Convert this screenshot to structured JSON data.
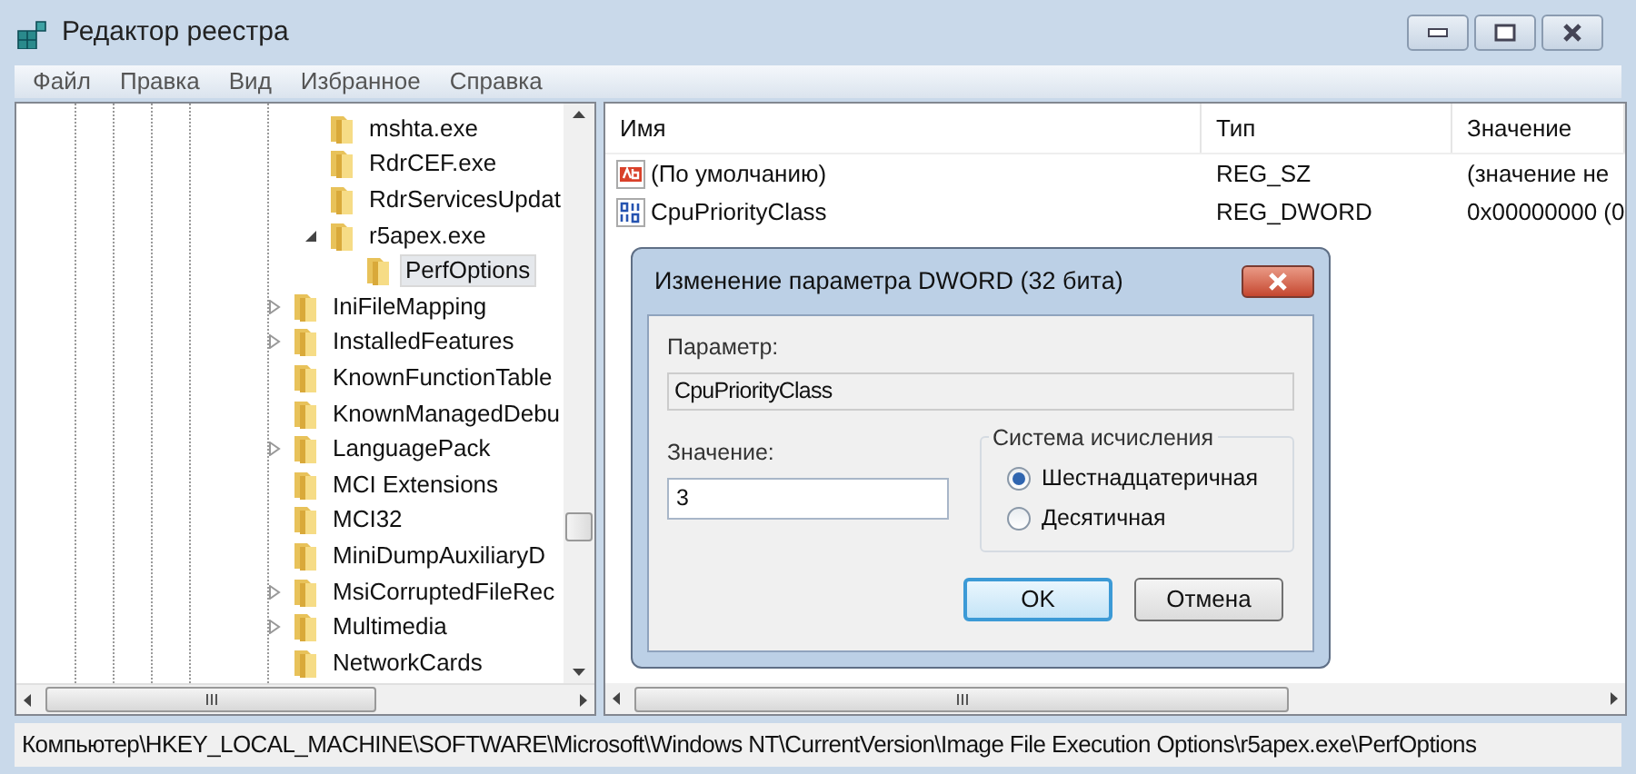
{
  "window": {
    "title": "Редактор реестра"
  },
  "menu": [
    "Файл",
    "Правка",
    "Вид",
    "Избранное",
    "Справка"
  ],
  "tree": {
    "upper_items": [
      {
        "label": "mshta.exe",
        "expandable": false,
        "selected": false
      },
      {
        "label": "RdrCEF.exe",
        "expandable": false,
        "selected": false
      },
      {
        "label": "RdrServicesUpdat",
        "expandable": false,
        "selected": false
      },
      {
        "label": "r5apex.exe",
        "expandable": true,
        "expanded": true,
        "selected": false,
        "children": [
          {
            "label": "PerfOptions",
            "expandable": false,
            "selected": true
          }
        ]
      }
    ],
    "items": [
      {
        "label": "IniFileMapping",
        "expandable": true,
        "selected": false
      },
      {
        "label": "InstalledFeatures",
        "expandable": true,
        "selected": false
      },
      {
        "label": "KnownFunctionTable",
        "expandable": false,
        "selected": false
      },
      {
        "label": "KnownManagedDebu",
        "expandable": false,
        "selected": false
      },
      {
        "label": "LanguagePack",
        "expandable": true,
        "selected": false
      },
      {
        "label": "MCI Extensions",
        "expandable": false,
        "selected": false
      },
      {
        "label": "MCI32",
        "expandable": false,
        "selected": false
      },
      {
        "label": "MiniDumpAuxiliaryD",
        "expandable": false,
        "selected": false
      },
      {
        "label": "MsiCorruptedFileRec",
        "expandable": true,
        "selected": false
      },
      {
        "label": "Multimedia",
        "expandable": true,
        "selected": false
      },
      {
        "label": "NetworkCards",
        "expandable": false,
        "selected": false
      }
    ]
  },
  "table": {
    "columns": [
      "Имя",
      "Тип",
      "Значение"
    ],
    "rows": [
      {
        "kind": "string",
        "name": "(По умолчанию)",
        "type": "REG_SZ",
        "value": "(значение не"
      },
      {
        "kind": "binary",
        "name": "CpuPriorityClass",
        "type": "REG_DWORD",
        "value": "0x00000000 (0"
      }
    ]
  },
  "dialog": {
    "title": "Изменение параметра DWORD (32 бита)",
    "name_label": "Параметр:",
    "name_value": "CpuPriorityClass",
    "value_label": "Значение:",
    "value": "3",
    "base_label": "Система исчисления",
    "bases": [
      {
        "label": "Шестнадцатеричная",
        "selected": true
      },
      {
        "label": "Десятичная",
        "selected": false
      }
    ],
    "buttons": [
      {
        "label": "OK",
        "default": true
      },
      {
        "label": "Отмена",
        "default": false
      }
    ]
  },
  "status_bar": "Компьютер\\HKEY_LOCAL_MACHINE\\SOFTWARE\\Microsoft\\Windows NT\\CurrentVersion\\Image File Execution Options\\r5apex.exe\\PerfOptions"
}
